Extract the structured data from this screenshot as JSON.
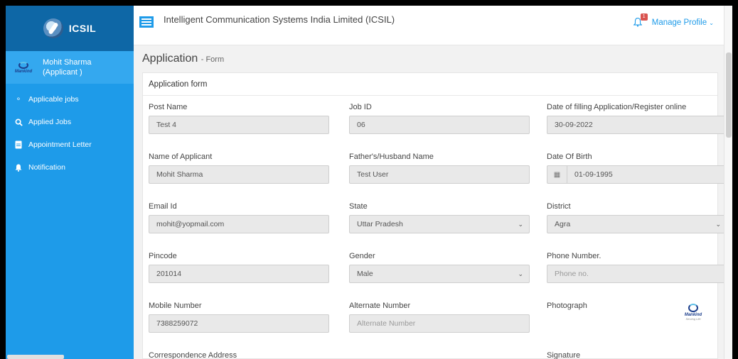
{
  "brand": {
    "name": "ICSIL"
  },
  "user": {
    "name": "Mohit Sharma",
    "role": "(Applicant )",
    "logo_text": "Mankind"
  },
  "nav": [
    {
      "label": "Applicable jobs",
      "icon": "handshake-icon"
    },
    {
      "label": "Applied Jobs",
      "icon": "search-icon"
    },
    {
      "label": "Appointment Letter",
      "icon": "document-icon"
    },
    {
      "label": "Notification",
      "icon": "bell-icon"
    }
  ],
  "topbar": {
    "org_title": "Intelligent Communication Systems India Limited (ICSIL)",
    "notification_count": "1",
    "manage_profile": "Manage Profile"
  },
  "page": {
    "title": "Application",
    "subtitle": "- Form",
    "card_title": "Application form"
  },
  "form": {
    "post_name": {
      "label": "Post Name",
      "value": "Test 4"
    },
    "job_id": {
      "label": "Job ID",
      "value": "06"
    },
    "date_filling": {
      "label": "Date of filling Application/Register online",
      "value": "30-09-2022"
    },
    "applicant_name": {
      "label": "Name of Applicant",
      "value": "Mohit Sharma"
    },
    "father_name": {
      "label": "Father's/Husband Name",
      "value": "Test User"
    },
    "dob": {
      "label": "Date Of Birth",
      "value": "01-09-1995"
    },
    "email": {
      "label": "Email Id",
      "value": "mohit@yopmail.com"
    },
    "state": {
      "label": "State",
      "value": "Uttar Pradesh"
    },
    "district": {
      "label": "District",
      "value": "Agra"
    },
    "pincode": {
      "label": "Pincode",
      "value": "201014"
    },
    "gender": {
      "label": "Gender",
      "value": "Male"
    },
    "phone": {
      "label": "Phone Number.",
      "placeholder": "Phone no."
    },
    "mobile": {
      "label": "Mobile Number",
      "value": "7388259072"
    },
    "alternate": {
      "label": "Alternate Number",
      "placeholder": "Alternate Number"
    },
    "photograph": {
      "label": "Photograph",
      "logo_text": "Mankind",
      "logo_tag": "Serving Life"
    },
    "corr_address": {
      "label": "Correspondence Address"
    },
    "signature": {
      "label": "Signature"
    }
  },
  "colors": {
    "sidebar": "#1e9be9",
    "brand_bar": "#0e67a6",
    "accent": "#1e9be9",
    "badge": "#d9534f"
  }
}
